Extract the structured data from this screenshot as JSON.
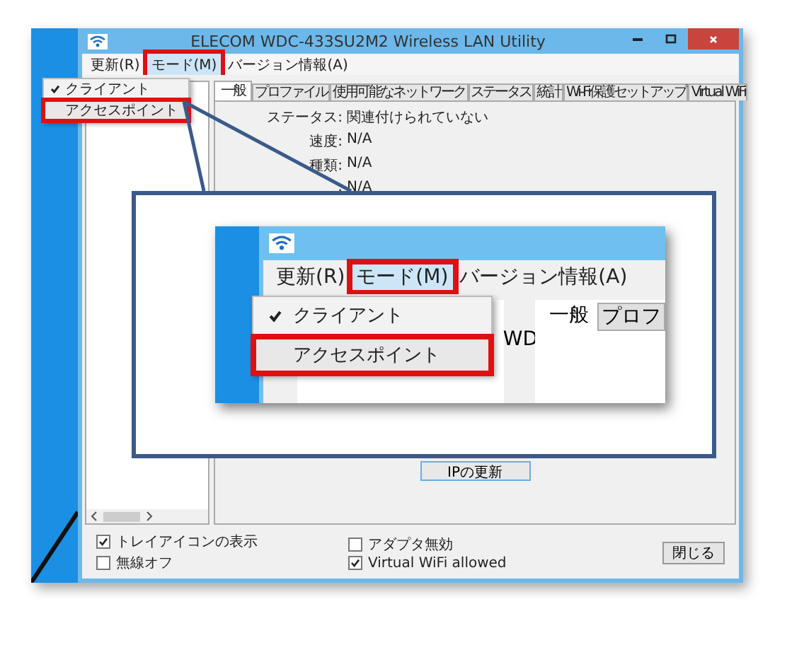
{
  "window": {
    "title": "ELECOM WDC-433SU2M2 Wireless LAN Utility"
  },
  "menu_bar": [
    {
      "label": "更新(R)",
      "highlighted": false
    },
    {
      "label": "モード(M)",
      "highlighted": true
    },
    {
      "label": "バージョン情報(A)",
      "highlighted": false
    }
  ],
  "mode_menu": [
    {
      "label": "クライアント",
      "checked": true,
      "highlighted": false
    },
    {
      "label": "アクセスポイント",
      "checked": false,
      "highlighted": true
    }
  ],
  "tabs": [
    {
      "label": "一般",
      "selected": true
    },
    {
      "label": "プロファイル",
      "selected": false
    },
    {
      "label": "使用可能なネットワーク",
      "selected": false
    },
    {
      "label": "ステータス",
      "selected": false
    },
    {
      "label": "統計",
      "selected": false
    },
    {
      "label": "Wi-Fi保護セットアップ",
      "selected": false
    },
    {
      "label": "Virtual WiFi",
      "selected": false
    }
  ],
  "status_fields": [
    {
      "label": "ステータス:",
      "value": "関連付けられていない"
    },
    {
      "label": "速度:",
      "value": "N/A"
    },
    {
      "label": "種類:",
      "value": "N/A"
    },
    {
      "label": ":",
      "value": "N/A"
    }
  ],
  "refresh_ip_button": "IPの更新",
  "options": [
    {
      "label": "トレイアイコンの表示",
      "checked": true
    },
    {
      "label": "無線オフ",
      "checked": false
    },
    {
      "label": "アダプタ無効",
      "checked": false
    },
    {
      "label": "Virtual WiFi allowed",
      "checked": true
    }
  ],
  "close_button": "閉じる",
  "callout": {
    "menu_bar": [
      {
        "label": "更新(R)",
        "highlighted": false
      },
      {
        "label": "モード(M)",
        "highlighted": true
      },
      {
        "label": "バージョン情報(A)",
        "highlighted": false
      }
    ],
    "mode_menu": [
      {
        "label": "クライアント",
        "checked": true,
        "highlighted": false
      },
      {
        "label": "アクセスポイント",
        "checked": false,
        "highlighted": true
      }
    ],
    "background_text": "WD",
    "tabs": [
      {
        "label": "一般",
        "selected": true
      },
      {
        "label": "プロフ",
        "selected": false
      }
    ]
  }
}
